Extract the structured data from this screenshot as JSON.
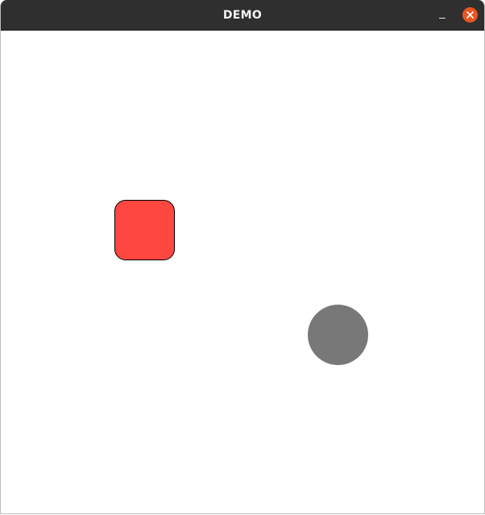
{
  "window": {
    "title": "DEMO"
  },
  "titlebar": {
    "buttons": {
      "minimize": {
        "icon": "minimize-icon"
      },
      "close": {
        "icon": "close-icon",
        "color": "#e95420"
      }
    }
  },
  "canvas": {
    "background": "#ffffff",
    "shapes": [
      {
        "type": "rounded-square",
        "fill": "#ff4741",
        "stroke": "#000000"
      },
      {
        "type": "circle",
        "fill": "#787878"
      }
    ]
  }
}
